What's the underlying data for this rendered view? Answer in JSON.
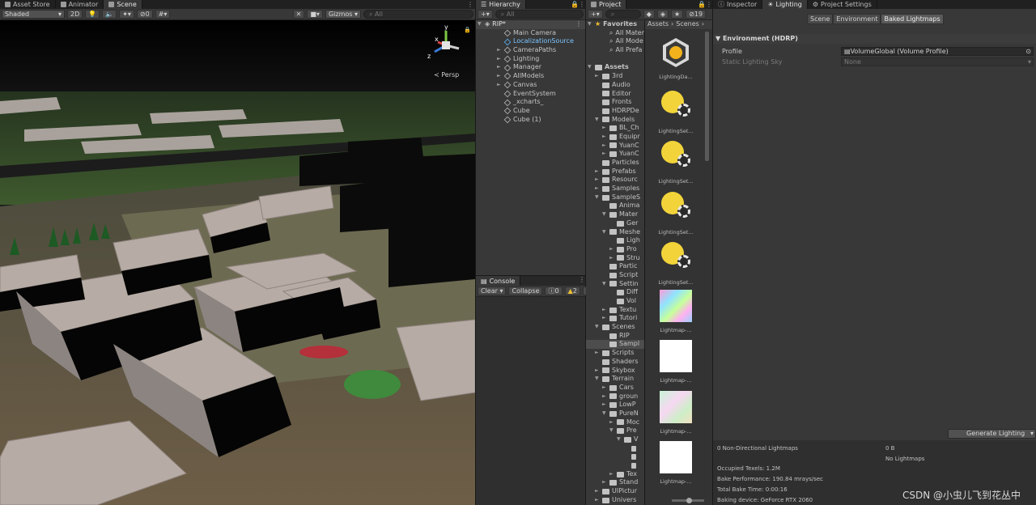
{
  "scene_tabs": [
    "Asset Store",
    "Animator",
    "Scene"
  ],
  "scene_toolbar": {
    "shading": "Shaded",
    "mode2d": "2D",
    "hidden_count": "0",
    "gizmos": "Gizmos",
    "search": "All"
  },
  "gizmo": {
    "y": "y",
    "z": "z",
    "x": "x",
    "persp": "Persp"
  },
  "hierarchy": {
    "tab": "Hierarchy",
    "search": "All",
    "scene": "RIP*",
    "items": [
      {
        "label": "Main Camera",
        "arrow": false,
        "selected": false
      },
      {
        "label": "LocalizationSource",
        "arrow": false,
        "selected": true
      },
      {
        "label": "CameraPaths",
        "arrow": true,
        "selected": false
      },
      {
        "label": "Lighting",
        "arrow": true,
        "selected": false
      },
      {
        "label": "Manager",
        "arrow": true,
        "selected": false
      },
      {
        "label": "AllModels",
        "arrow": true,
        "selected": false
      },
      {
        "label": "Canvas",
        "arrow": true,
        "selected": false
      },
      {
        "label": "EventSystem",
        "arrow": false,
        "selected": false
      },
      {
        "label": "_xcharts_",
        "arrow": false,
        "selected": false
      },
      {
        "label": "Cube",
        "arrow": false,
        "selected": false
      },
      {
        "label": "Cube (1)",
        "arrow": false,
        "selected": false
      }
    ]
  },
  "console": {
    "tab": "Console",
    "clear": "Clear",
    "collapse": "Collapse",
    "info_count": "0",
    "warn_count": "2"
  },
  "project": {
    "tab": "Project",
    "hidden_count": "19",
    "breadcrumb": [
      "Assets",
      "Scenes"
    ],
    "tree": [
      {
        "label": "Favorites",
        "indent": 0,
        "arrow": "▼",
        "kind": "star"
      },
      {
        "label": "All Mater",
        "indent": 2,
        "arrow": "",
        "kind": "search"
      },
      {
        "label": "All Mode",
        "indent": 2,
        "arrow": "",
        "kind": "search"
      },
      {
        "label": "All Prefa",
        "indent": 2,
        "arrow": "",
        "kind": "search"
      },
      {
        "label": "",
        "indent": 0,
        "arrow": "",
        "kind": "blank"
      },
      {
        "label": "Assets",
        "indent": 0,
        "arrow": "▼",
        "kind": "folder"
      },
      {
        "label": "3rd",
        "indent": 1,
        "arrow": "►",
        "kind": "folder"
      },
      {
        "label": "Audio",
        "indent": 1,
        "arrow": "",
        "kind": "folder"
      },
      {
        "label": "Editor",
        "indent": 1,
        "arrow": "",
        "kind": "folder"
      },
      {
        "label": "Fronts",
        "indent": 1,
        "arrow": "",
        "kind": "folder"
      },
      {
        "label": "HDRPDe",
        "indent": 1,
        "arrow": "",
        "kind": "folder"
      },
      {
        "label": "Models",
        "indent": 1,
        "arrow": "▼",
        "kind": "folder"
      },
      {
        "label": "BL_Ch",
        "indent": 2,
        "arrow": "►",
        "kind": "folder"
      },
      {
        "label": "Equipr",
        "indent": 2,
        "arrow": "►",
        "kind": "folder"
      },
      {
        "label": "YuanC",
        "indent": 2,
        "arrow": "►",
        "kind": "folder"
      },
      {
        "label": "YuanC",
        "indent": 2,
        "arrow": "►",
        "kind": "folder"
      },
      {
        "label": "Particles",
        "indent": 1,
        "arrow": "",
        "kind": "folder"
      },
      {
        "label": "Prefabs",
        "indent": 1,
        "arrow": "►",
        "kind": "folder"
      },
      {
        "label": "Resourc",
        "indent": 1,
        "arrow": "►",
        "kind": "folder"
      },
      {
        "label": "Samples",
        "indent": 1,
        "arrow": "►",
        "kind": "folder"
      },
      {
        "label": "SampleS",
        "indent": 1,
        "arrow": "▼",
        "kind": "folder"
      },
      {
        "label": "Anima",
        "indent": 2,
        "arrow": "",
        "kind": "folder"
      },
      {
        "label": "Mater",
        "indent": 2,
        "arrow": "▼",
        "kind": "folder"
      },
      {
        "label": "Ger",
        "indent": 3,
        "arrow": "",
        "kind": "folder"
      },
      {
        "label": "Meshe",
        "indent": 2,
        "arrow": "▼",
        "kind": "folder"
      },
      {
        "label": "Ligh",
        "indent": 3,
        "arrow": "",
        "kind": "folder"
      },
      {
        "label": "Pro",
        "indent": 3,
        "arrow": "►",
        "kind": "folder"
      },
      {
        "label": "Stru",
        "indent": 3,
        "arrow": "►",
        "kind": "folder"
      },
      {
        "label": "Partic",
        "indent": 2,
        "arrow": "",
        "kind": "folder"
      },
      {
        "label": "Script",
        "indent": 2,
        "arrow": "",
        "kind": "folder"
      },
      {
        "label": "Settin",
        "indent": 2,
        "arrow": "▼",
        "kind": "folder"
      },
      {
        "label": "Diff",
        "indent": 3,
        "arrow": "",
        "kind": "folder"
      },
      {
        "label": "Vol",
        "indent": 3,
        "arrow": "",
        "kind": "folder"
      },
      {
        "label": "Textu",
        "indent": 2,
        "arrow": "►",
        "kind": "folder"
      },
      {
        "label": "Tutori",
        "indent": 2,
        "arrow": "►",
        "kind": "folder"
      },
      {
        "label": "Scenes",
        "indent": 1,
        "arrow": "▼",
        "kind": "folder"
      },
      {
        "label": "RIP",
        "indent": 2,
        "arrow": "",
        "kind": "folder"
      },
      {
        "label": "Sampl",
        "indent": 2,
        "arrow": "",
        "kind": "folder",
        "selected": true
      },
      {
        "label": "Scripts",
        "indent": 1,
        "arrow": "►",
        "kind": "folder"
      },
      {
        "label": "Shaders",
        "indent": 1,
        "arrow": "",
        "kind": "folder"
      },
      {
        "label": "Skybox",
        "indent": 1,
        "arrow": "►",
        "kind": "folder"
      },
      {
        "label": "Terrain",
        "indent": 1,
        "arrow": "▼",
        "kind": "folder"
      },
      {
        "label": "Cars",
        "indent": 2,
        "arrow": "►",
        "kind": "folder"
      },
      {
        "label": "groun",
        "indent": 2,
        "arrow": "►",
        "kind": "folder"
      },
      {
        "label": "LowP",
        "indent": 2,
        "arrow": "►",
        "kind": "folder"
      },
      {
        "label": "PureN",
        "indent": 2,
        "arrow": "▼",
        "kind": "folder"
      },
      {
        "label": "Moc",
        "indent": 3,
        "arrow": "►",
        "kind": "folder"
      },
      {
        "label": "Pre",
        "indent": 3,
        "arrow": "▼",
        "kind": "folder"
      },
      {
        "label": "V",
        "indent": 4,
        "arrow": "▼",
        "kind": "folder"
      },
      {
        "label": "",
        "indent": 5,
        "arrow": "",
        "kind": "file"
      },
      {
        "label": "",
        "indent": 5,
        "arrow": "",
        "kind": "file"
      },
      {
        "label": "",
        "indent": 5,
        "arrow": "",
        "kind": "file"
      },
      {
        "label": "Tex",
        "indent": 3,
        "arrow": "►",
        "kind": "folder"
      },
      {
        "label": "Stand",
        "indent": 2,
        "arrow": "►",
        "kind": "folder"
      },
      {
        "label": "UIPictur",
        "indent": 1,
        "arrow": "►",
        "kind": "folder"
      },
      {
        "label": "Univers",
        "indent": 1,
        "arrow": "►",
        "kind": "folder"
      }
    ],
    "assets": [
      {
        "label": "LightingDa...",
        "kind": "data"
      },
      {
        "label": "LightingSet...",
        "kind": "settings"
      },
      {
        "label": "LightingSet...",
        "kind": "settings"
      },
      {
        "label": "LightingSet...",
        "kind": "settings"
      },
      {
        "label": "LightingSet...",
        "kind": "settings"
      },
      {
        "label": "Lightmap-...",
        "kind": "lightmap-noise"
      },
      {
        "label": "Lightmap-...",
        "kind": "lightmap-white"
      },
      {
        "label": "Lightmap-...",
        "kind": "lightmap-pastel"
      },
      {
        "label": "Lightmap-...",
        "kind": "lightmap-white"
      }
    ]
  },
  "right_tabs": [
    "Inspector",
    "Lighting",
    "Project Settings"
  ],
  "lighting": {
    "subtabs": [
      "Scene",
      "Environment",
      "Baked Lightmaps"
    ],
    "section": "Environment (HDRP)",
    "profile_label": "Profile",
    "profile_value": "VolumeGlobal (Volume Profile)",
    "sky_label": "Static Lighting Sky",
    "sky_value": "None",
    "generate": "Generate Lighting",
    "stats": {
      "lightmaps": "0 Non-Directional Lightmaps",
      "size": "0 B",
      "no_lightmaps": "No Lightmaps",
      "texels": "Occupied Texels: 1.2M",
      "performance": "Bake Performance: 190.84 mrays/sec",
      "time": "Total Bake Time: 0:00:16",
      "device": "Baking device: GeForce RTX 2060"
    }
  },
  "watermark": "CSDN @小虫儿飞到花丛中"
}
